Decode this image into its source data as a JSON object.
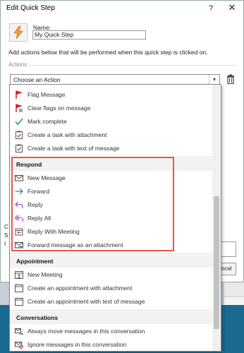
{
  "window": {
    "title": "Edit Quick Step",
    "help": "?",
    "close": "✕"
  },
  "name_label": "Name:",
  "name_value": "My Quick Step",
  "instructions": "Add actions below that will be performed when this quick step is clicked on.",
  "actions_label": "Actions",
  "combo": {
    "value": "Choose an Action"
  },
  "background": {
    "cancel_partial": "ncel",
    "letter_a": "C",
    "letter_b": "S",
    "letter_c": "I"
  },
  "accent_color": "#e8574b",
  "sections": {
    "flags": [
      {
        "label": "Flag Message",
        "icon": "red-flag-icon"
      },
      {
        "label": "Clear flags on message",
        "icon": "flag-clear-icon"
      },
      {
        "label": "Mark complete",
        "icon": "checkmark-icon"
      },
      {
        "label": "Create a task with attachment",
        "icon": "task-clipboard-icon"
      },
      {
        "label": "Create a task with text of message",
        "icon": "task-clipboard-icon"
      }
    ],
    "respond": {
      "title": "Respond",
      "items": [
        {
          "label": "New Message",
          "icon": "envelope-icon"
        },
        {
          "label": "Forward",
          "icon": "forward-arrow-icon"
        },
        {
          "label": "Reply",
          "icon": "reply-arrow-icon"
        },
        {
          "label": "Reply All",
          "icon": "reply-all-icon"
        },
        {
          "label": "Reply With Meeting",
          "icon": "reply-meeting-icon"
        },
        {
          "label": "Forward message as an attachment",
          "icon": "forward-attachment-icon"
        }
      ]
    },
    "appointment": {
      "title": "Appointment",
      "items": [
        {
          "label": "New Meeting",
          "icon": "calendar-people-icon"
        },
        {
          "label": "Create an appointment with attachment",
          "icon": "calendar-icon"
        },
        {
          "label": "Create an appointment with text of message",
          "icon": "calendar-icon"
        }
      ]
    },
    "conversations": {
      "title": "Conversations",
      "items": [
        {
          "label": "Always move messages in this conversation",
          "icon": "move-folder-icon"
        },
        {
          "label": "Ignore messages in this conversation",
          "icon": "ignore-envelope-icon"
        }
      ]
    }
  }
}
